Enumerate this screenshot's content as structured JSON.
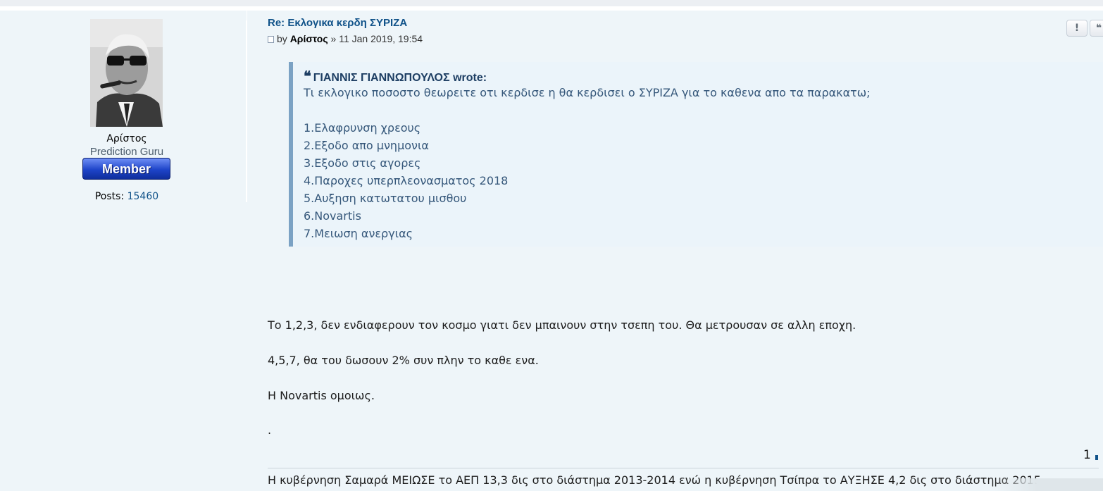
{
  "post": {
    "title": "Re: Εκλογικα κερδη ΣΥΡΙΖΑ",
    "meta_by": "by",
    "author": "Αρίστος",
    "meta_sep": "»",
    "timestamp": "11 Jan 2019, 19:54",
    "report_label": "!",
    "quote_label": "❝"
  },
  "profile": {
    "username": "Αρίστος",
    "rank_title": "Prediction Guru",
    "rank_badge": "Member",
    "posts_label": "Posts:",
    "posts_count": "15460"
  },
  "quote": {
    "author": "ΓΙΑΝΝΙΣ ΓΙΑΝΝΩΠΟΥΛΟΣ",
    "wrote": "wrote:",
    "question": "Τι εκλογικο ποσοστο θεωρειτε οτι κερδισε η θα κερδισει ο ΣΥΡΙΖΑ για το καθενα απο τα παρακατω;",
    "items": [
      "1.Ελαφρυνση χρεους",
      "2.Εξοδο απο μνημονια",
      "3.Εξοδο στις αγορες",
      "4.Παροχες υπερπλεονασματος 2018",
      "5.Αυξηση κατωτατου μισθου",
      "6.Novartis",
      "7.Μειωση ανεργιας"
    ]
  },
  "body": {
    "paragraphs": [
      "Το 1,2,3, δεν ενδιαφερουν τον κοσμο γιατι δεν μπαινουν στην τσεπη του. Θα μετρουσαν σε αλλη εποχη.",
      "4,5,7, θα του δωσουν 2% συν πλην το καθε ενα.",
      "Η Novartis ομοιως.",
      "."
    ]
  },
  "pager": {
    "value": "1"
  },
  "signature": {
    "text": "Η κυβέρνηση Σαμαρά ΜΕΙΩΣΕ το ΑΕΠ 13,3 δις στο διάστημα 2013-2014 ενώ η κυβέρνηση Τσίπρα το ΑΥΞΗΣΕ 4,2 δις στο διάστημα 2015-"
  }
}
